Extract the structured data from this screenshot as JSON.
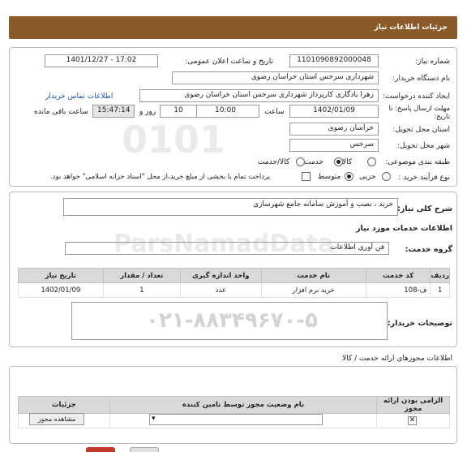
{
  "header": {
    "title": "جزئیات اطلاعات نیاز"
  },
  "need_number": {
    "label": "شماره نیاز:",
    "value": "1101090892000048"
  },
  "announce_date": {
    "label": "تاریخ و ساعت اعلان عمومی:",
    "value": "1401/12/27 - 17:02"
  },
  "buyer_org": {
    "label": "نام دستگاه خریدار:",
    "value": "شهرداری سرخس استان خراسان رضوی"
  },
  "requester": {
    "label": "ایجاد کننده درخواست:",
    "value": "زهرا یادگاری کارپرداز شهرداری سرخس استان خراسان رضوی",
    "contact_link": "اطلاعات تماس خریدار"
  },
  "deadline": {
    "label": "مهلت ارسال پاسخ: تا تاریخ:",
    "date": "1402/01/09",
    "time_label": "ساعت",
    "time": "10:00",
    "days": "10",
    "days_label": "روز و",
    "remaining": "15:47:14",
    "remaining_label": "ساعت باقی مانده"
  },
  "province": {
    "label": "استان محل تحویل:",
    "value": "خراسان رضوی"
  },
  "city": {
    "label": "شهر محل تحویل:",
    "value": "سرخس"
  },
  "category": {
    "label": "طبقه بندی موضوعی:",
    "options": [
      "کالا",
      "خدمت",
      "کالا/خدمت"
    ],
    "selected": "خدمت"
  },
  "purchase_type": {
    "label": "نوع فرآیند خرید :",
    "options": [
      "جزیی",
      "متوسط"
    ],
    "selected": "متوسط",
    "note": "پرداخت تمام یا بخشی از مبلغ خرید،از محل \"اسناد خزانه اسلامی\" خواهد بود."
  },
  "summary": {
    "label": "شرح کلی نیاز:",
    "value": "خرید ، نصب و آموزش سامانه جامع شهرسازی"
  },
  "services": {
    "title": "اطلاعات خدمات مورد نیاز",
    "group_label": "گروه خدمت:",
    "group_value": "فن آوری اطلاعات",
    "columns": [
      "ردیف",
      "کد خدمت",
      "نام خدمت",
      "واحد اندازه گیری",
      "تعداد / مقدار",
      "تاریخ نیاز"
    ],
    "rows": [
      [
        "1",
        "ف-108",
        "خرید نرم افزار",
        "عدد",
        "1",
        "1402/01/09"
      ]
    ]
  },
  "buyer_notes": {
    "label": "توضیحات خریدار:",
    "value": ""
  },
  "permits": {
    "title": "اطلاعات مجوزهای ارائه خدمت / کالا",
    "columns": [
      "الزامی بودن ارائه مجوز",
      "نام وضعیت مجوز توسط تامین کننده",
      "جزئیات"
    ],
    "view_button": "مشاهده مجوز"
  },
  "watermark": {
    "brand": "ParsNamadData",
    "phone": "۰۲۱-۸۸۳۴۹۶۷۰-۵"
  },
  "colors": {
    "header": "#8a5a2b",
    "link": "#1a4fa8",
    "panel_border": "#bdbdbd",
    "table_head": "#d9d9d9"
  }
}
